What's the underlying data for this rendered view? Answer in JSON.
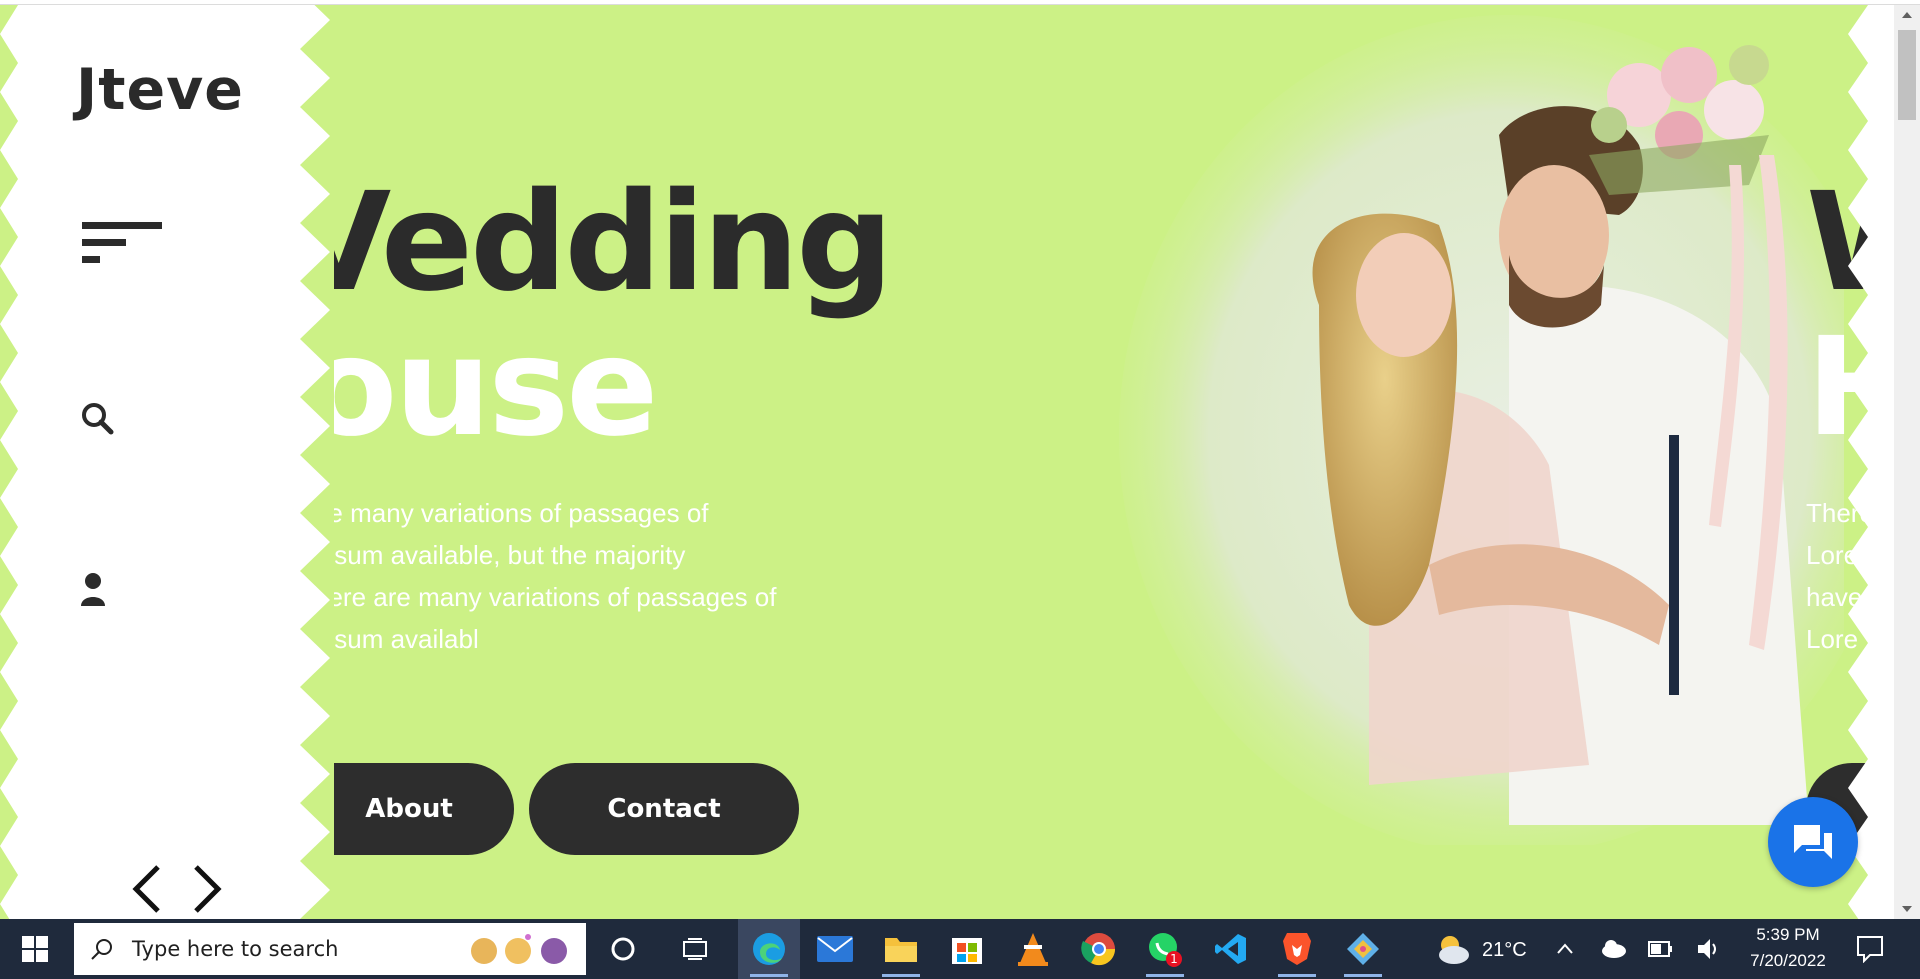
{
  "site": {
    "logo": "Jteve",
    "heading_line1": "Vedding",
    "heading_line2": "ouse",
    "paragraph": [
      "ire many variations of passages of",
      "lpsum available, but the majority",
      "nere are many variations of passages of",
      "lpsum availabl"
    ],
    "buttons": {
      "about": "About",
      "contact": "Contact"
    },
    "next_slide": {
      "heading_line1": "W",
      "heading_line2": "H",
      "paragraph": [
        "There",
        "Lore",
        "have",
        "Lore"
      ]
    }
  },
  "icons": {
    "menu": "hamburger-menu-icon",
    "search": "search-icon",
    "user": "user-icon",
    "prev": "chevron-left-icon",
    "next": "chevron-right-icon",
    "chat": "chat-bubble-icon"
  },
  "colors": {
    "background": "#ccf186",
    "sidebar": "#ffffff",
    "dark": "#2b2b2b",
    "chat": "#1a73e8",
    "taskbar": "#1f2a3c"
  },
  "taskbar": {
    "search_placeholder": "Type here to search",
    "apps": [
      "task-view",
      "edge",
      "mail",
      "file-explorer",
      "store",
      "vlc",
      "chrome",
      "whatsapp",
      "vscode",
      "brave",
      "git-kraken"
    ],
    "whatsapp_badge": "1",
    "weather": "21°C",
    "time": "5:39 PM",
    "date": "7/20/2022"
  }
}
